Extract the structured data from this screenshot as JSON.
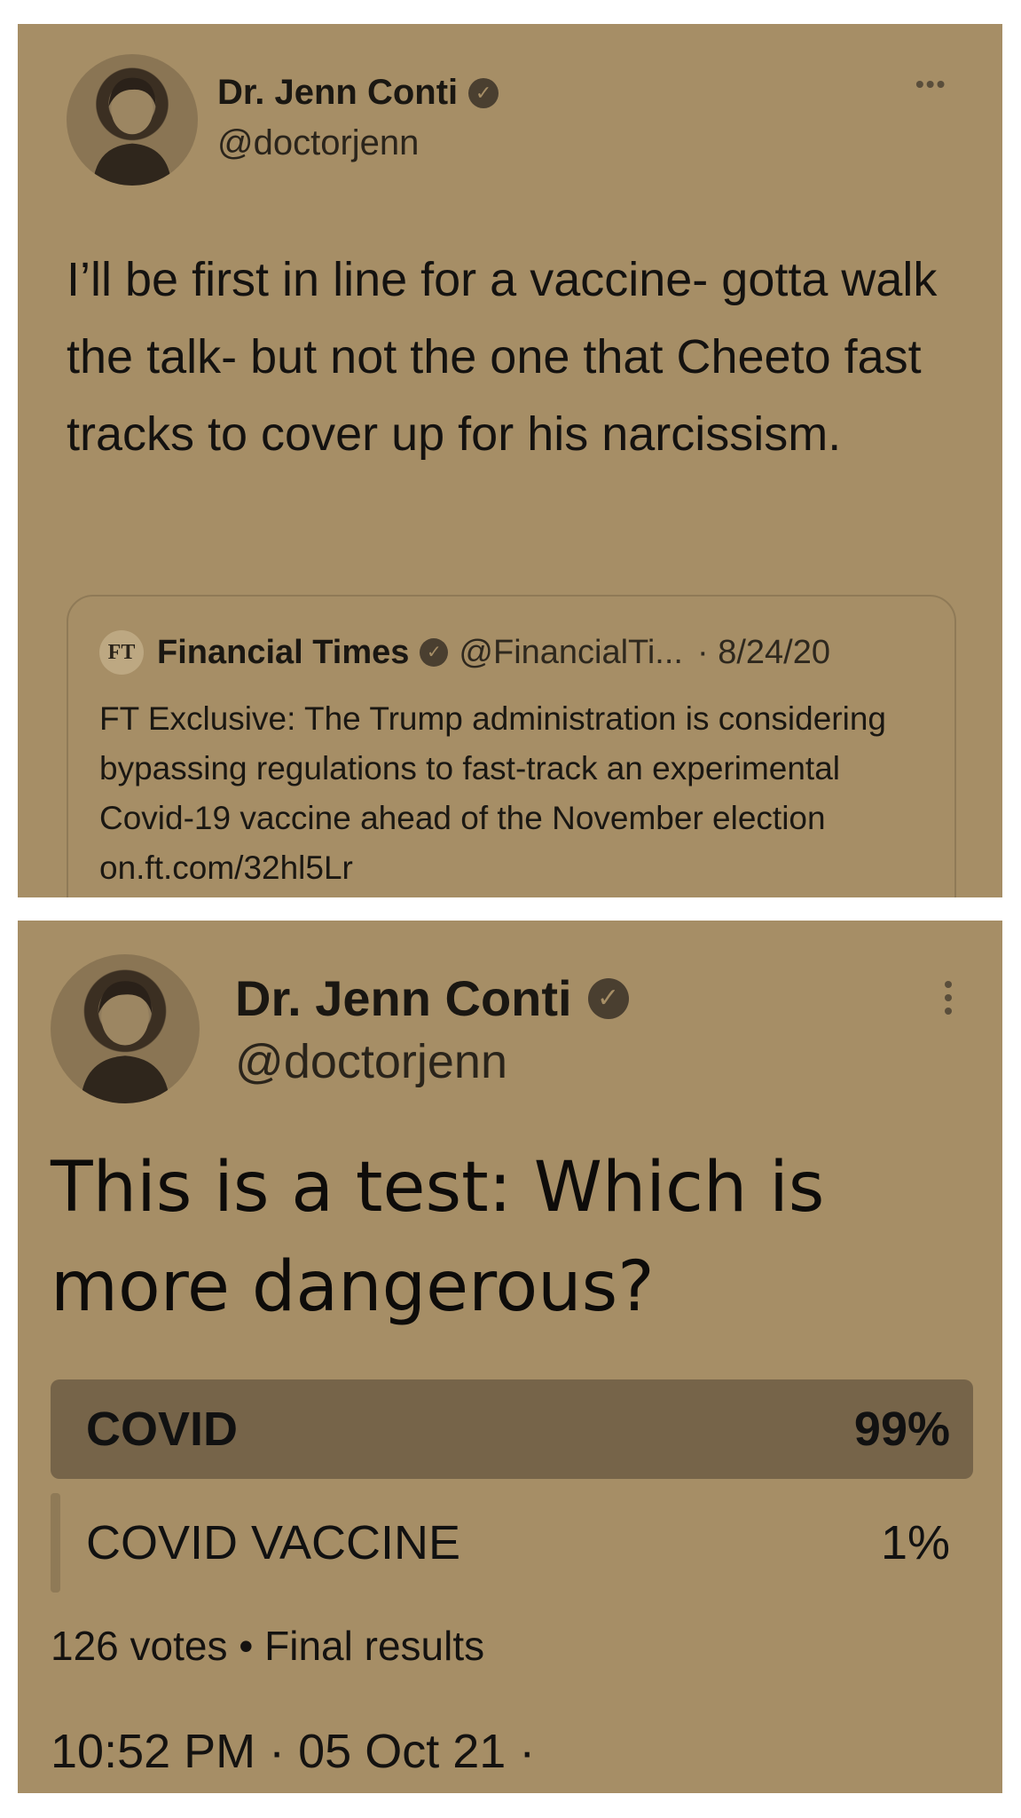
{
  "tweet1": {
    "author_name": "Dr. Jenn Conti",
    "handle": "@doctorjenn",
    "verified_icon": "✓",
    "more_icon": "•••",
    "text": "I’ll be first in line for a vaccine- gotta walk the talk- but not the one that Cheeto fast tracks to cover up for his narcissism.",
    "quote": {
      "logo_text": "FT",
      "author_name": "Financial Times",
      "handle": "@FinancialTi...",
      "date": "· 8/24/20",
      "text": "FT Exclusive: The Trump administration is considering bypassing regulations to fast-track an experimental Covid-19 vaccine ahead of the November election on.ft.com/32hl5Lr"
    }
  },
  "tweet2": {
    "author_name": "Dr. Jenn Conti",
    "handle": "@doctorjenn",
    "verified_icon": "✓",
    "text": "This is a test: Which is more dangerous?",
    "poll": {
      "options": [
        {
          "label": "COVID",
          "percent_text": "99%",
          "percent": 99
        },
        {
          "label": "COVID VACCINE",
          "percent_text": "1%",
          "percent": 1
        }
      ],
      "meta": "126 votes • Final results"
    },
    "timestamp": "10:52 PM · 05 Oct 21 ·"
  },
  "colors": {
    "panel_bg": "#a68e66",
    "winning_bar": "#766449",
    "losing_bar": "#8f7a57"
  }
}
